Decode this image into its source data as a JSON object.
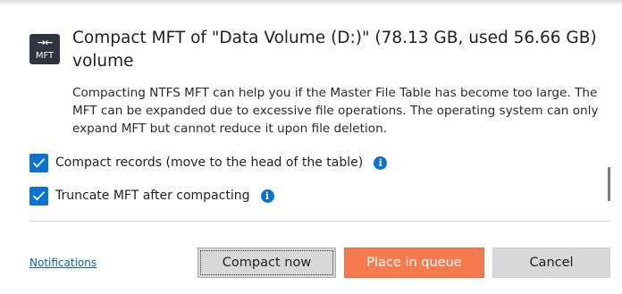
{
  "dialog": {
    "icon": {
      "arrows": "→←",
      "label": "MFT"
    },
    "title": "Compact MFT of \"Data Volume (D:)\" (78.13 GB, used 56.66 GB) volume",
    "description": "Compacting NTFS MFT can help you if the Master File Table has become too large. The MFT can be expanded due to excessive file operations. The operating system can only expand MFT but cannot reduce it upon file deletion."
  },
  "options": [
    {
      "label": "Compact records (move to the head of the table)",
      "checked": true,
      "info_icon": "info-icon"
    },
    {
      "label": "Truncate MFT after compacting",
      "checked": true,
      "info_icon": "info-icon"
    }
  ],
  "footer": {
    "notifications_link": "Notifications",
    "compact_now_label": "Compact now",
    "place_in_queue_label": "Place in queue",
    "cancel_label": "Cancel"
  },
  "colors": {
    "accent": "#0a73d1",
    "primary_button": "#f57b4e",
    "secondary_button": "#d8d8d8",
    "link": "#0a5fb4",
    "icon_background": "#2e3440"
  }
}
